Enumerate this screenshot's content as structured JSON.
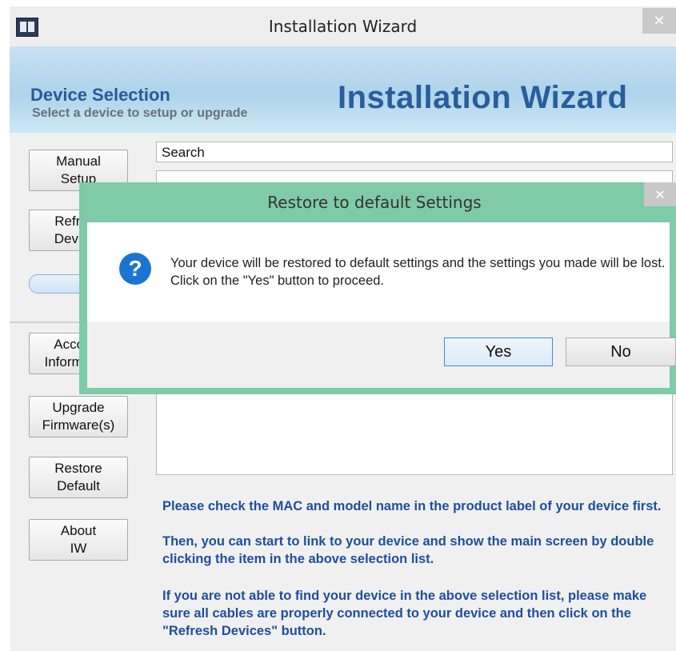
{
  "window": {
    "title": "Installation Wizard",
    "close_glyph": "✕",
    "icon": "app-icon"
  },
  "banner": {
    "title": "Device Selection",
    "subtitle": "Select a device to setup or upgrade",
    "logo_text": "Installation Wizard"
  },
  "sidebar": {
    "manual_setup": [
      "Manual",
      "Setup"
    ],
    "refresh_devices": [
      "Refresh",
      "Devices"
    ],
    "account_information": [
      "Account",
      "Information"
    ],
    "upgrade_firmware": [
      "Upgrade",
      "Firmware(s)"
    ],
    "restore_default": [
      "Restore",
      "Default"
    ],
    "about_iw": [
      "About",
      "IW"
    ]
  },
  "search": {
    "value": "Search"
  },
  "info": {
    "paragraph1": "Please check the MAC and model name in the product label of your device first.",
    "paragraph2": "Then, you can start to link to your device and show the main screen by double clicking the item in the above selection list.",
    "paragraph3": "If you are not able to find your device in the above selection list, please make sure all cables are properly connected to your device and then click on the \"Refresh Devices\" button."
  },
  "dialog": {
    "title": "Restore to default Settings",
    "close_glyph": "✕",
    "icon_glyph": "?",
    "message": "Your device will be restored to default settings and the settings you made will be lost. Click on the \"Yes\" button to proceed.",
    "yes_label": "Yes",
    "no_label": "No",
    "accent_color": "#7fcaa7"
  },
  "colors": {
    "info_text": "#1f4e9e",
    "banner_title": "#2a5a97"
  }
}
